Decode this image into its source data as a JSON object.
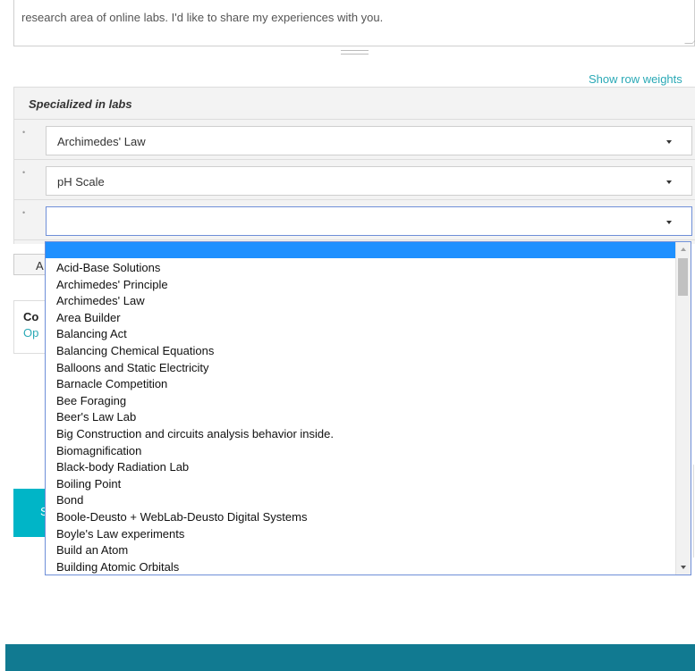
{
  "description_box": {
    "text": "research area of online labs. I'd like to share my experiences with you."
  },
  "show_row_weights": "Show row weights",
  "labs_table": {
    "header": "Specialized in labs",
    "rows": [
      {
        "selected": "Archimedes' Law"
      },
      {
        "selected": "pH Scale"
      },
      {
        "selected": ""
      }
    ]
  },
  "add_button": {
    "label": "A"
  },
  "card": {
    "title": "Co",
    "link": "Op"
  },
  "submit_button": {
    "label": "S"
  },
  "dropdown": {
    "highlighted": "",
    "options": [
      "Acid-Base Solutions",
      "Archimedes' Principle",
      "Archimedes' Law",
      "Area Builder",
      "Balancing Act",
      "Balancing Chemical Equations",
      "Balloons and Static Electricity",
      "Barnacle Competition",
      "Bee Foraging",
      "Beer's Law Lab",
      "Big Construction and circuits analysis behavior inside.",
      "Biomagnification",
      "Black-body Radiation Lab",
      "Boiling Point",
      "Bond",
      "Boole-Deusto + WebLab-Deusto Digital Systems",
      "Boyle's Law experiments",
      "Build an Atom",
      "Building Atomic Orbitals"
    ]
  },
  "colors": {
    "accent_teal": "#00b5c7",
    "link_teal": "#2aa9b6",
    "footer": "#117a91",
    "highlight_blue": "#1e90ff"
  }
}
